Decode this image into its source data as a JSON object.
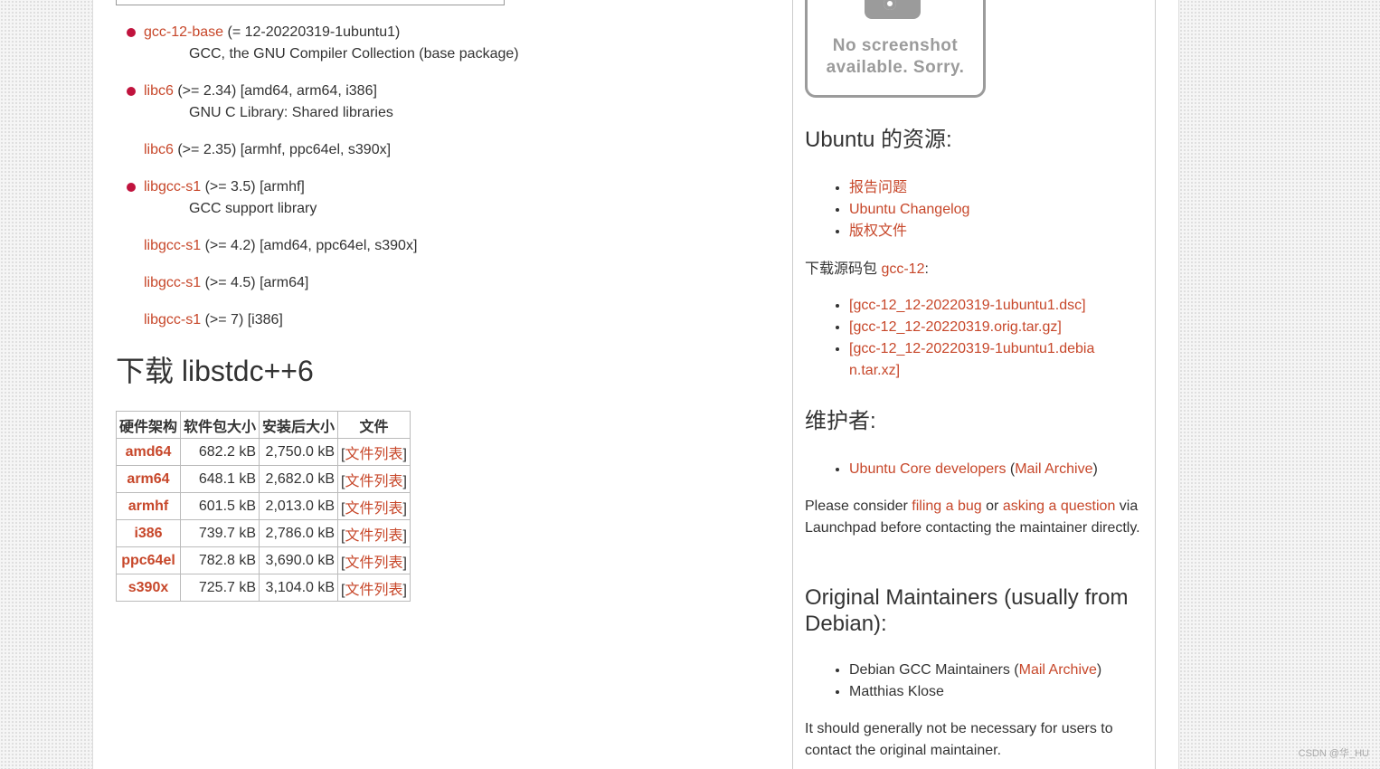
{
  "deps": [
    {
      "link": "gcc-12-base",
      "rest": " (= 12-20220319-1ubuntu1)",
      "desc": "GCC, the GNU Compiler Collection (base package)",
      "bullet": true
    },
    {
      "link": "libc6",
      "rest": " (>= 2.34) [amd64, arm64, i386]",
      "desc": "GNU C Library: Shared libraries",
      "bullet": true
    },
    {
      "link": "libc6",
      "rest": " (>= 2.35) [armhf, ppc64el, s390x]",
      "desc": "",
      "bullet": false
    },
    {
      "link": "libgcc-s1",
      "rest": " (>= 3.5) [armhf]",
      "desc": "GCC support library",
      "bullet": true
    },
    {
      "link": "libgcc-s1",
      "rest": " (>= 4.2) [amd64, ppc64el, s390x]",
      "desc": "",
      "bullet": false
    },
    {
      "link": "libgcc-s1",
      "rest": " (>= 4.5) [arm64]",
      "desc": "",
      "bullet": false
    },
    {
      "link": "libgcc-s1",
      "rest": " (>= 7) [i386]",
      "desc": "",
      "bullet": false
    }
  ],
  "download": {
    "title": "下载 libstdc++6",
    "headers": [
      "硬件架构",
      "软件包大小",
      "安装后大小",
      "文件"
    ],
    "rows": [
      {
        "arch": "amd64",
        "size": "682.2 kB",
        "installed": "2,750.0 kB",
        "files": "文件列表"
      },
      {
        "arch": "arm64",
        "size": "648.1 kB",
        "installed": "2,682.0 kB",
        "files": "文件列表"
      },
      {
        "arch": "armhf",
        "size": "601.5 kB",
        "installed": "2,013.0 kB",
        "files": "文件列表"
      },
      {
        "arch": "i386",
        "size": "739.7 kB",
        "installed": "2,786.0 kB",
        "files": "文件列表"
      },
      {
        "arch": "ppc64el",
        "size": "782.8 kB",
        "installed": "3,690.0 kB",
        "files": "文件列表"
      },
      {
        "arch": "s390x",
        "size": "725.7 kB",
        "installed": "3,104.0 kB",
        "files": "文件列表"
      }
    ]
  },
  "sidebar": {
    "screenshot_text": "No screenshot available. Sorry.",
    "resources_title": "Ubuntu 的资源:",
    "resources": [
      "报告问题",
      "Ubuntu Changelog",
      "版权文件"
    ],
    "source_label": "下载源码包 ",
    "source_link": "gcc-12",
    "source_colon": ":",
    "source_files": [
      "[gcc-12_12-20220319-1ubuntu1.dsc]",
      "[gcc-12_12-20220319.orig.tar.gz]",
      "[gcc-12_12-20220319-1ubuntu1.debian.tar.xz]"
    ],
    "maintainer_title": "维护者:",
    "maintainer_name": "Ubuntu Core developers",
    "maintainer_archive": "Mail Archive",
    "consider": {
      "p1": "Please consider ",
      "link1": "filing a bug",
      "p2": " or ",
      "link2": "asking a question",
      "p3": " via Launchpad before contacting the maintainer directly."
    },
    "original_title": "Original Maintainers (usually from Debian):",
    "original_name": "Debian GCC Maintainers",
    "original_archive": "Mail Archive",
    "original_person": "Matthias Klose",
    "note": "It should generally not be necessary for users to contact the original maintainer."
  },
  "watermark": "CSDN @华_HU",
  "colors": {
    "link": "#c7472a",
    "bullet": "#c0133d",
    "text": "#333333"
  }
}
